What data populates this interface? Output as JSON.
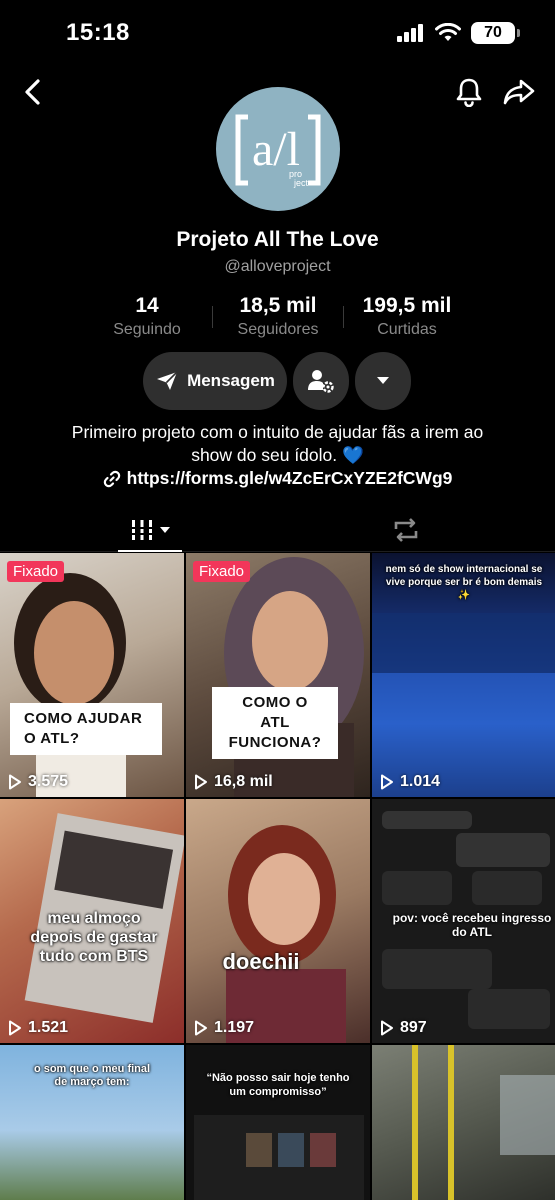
{
  "status_bar": {
    "time": "15:18",
    "battery": "70"
  },
  "profile": {
    "name": "Projeto All The Love",
    "handle": "@alloveproject",
    "avatar_text": "a/l",
    "avatar_sub": "pro ject"
  },
  "stats": [
    {
      "value": "14",
      "label": "Seguindo"
    },
    {
      "value": "18,5 mil",
      "label": "Seguidores"
    },
    {
      "value": "199,5 mil",
      "label": "Curtidas"
    }
  ],
  "actions": {
    "message_label": "Mensagem"
  },
  "bio": {
    "line1": "Primeiro projeto com o intuito de ajudar fãs a irem ao",
    "line2": "show do seu ídolo. 💙",
    "link": "https://forms.gle/w4ZcErCxYZE2fCWg9"
  },
  "videos": [
    {
      "pinned": "Fixado",
      "caption": "COMO AJUDAR O ATL?",
      "views": "3.575"
    },
    {
      "pinned": "Fixado",
      "caption": "COMO O ATL FUNCIONA?",
      "views": "16,8 mil"
    },
    {
      "caption": "nem só de show internacional se vive porque ser br é bom demais ✨",
      "views": "1.014"
    },
    {
      "caption": "meu almoço depois de gastar tudo com BTS",
      "views": "1.521"
    },
    {
      "caption": "doechii",
      "views": "1.197"
    },
    {
      "caption": "pov: você recebeu ingresso do ATL",
      "views": "897"
    },
    {
      "caption": "o som que o meu final de março tem:",
      "views": ""
    },
    {
      "caption": "“Não posso sair hoje tenho um compromisso”",
      "views": ""
    },
    {
      "caption": "",
      "views": ""
    }
  ],
  "colors": {
    "pinned_badge": "#f2365a",
    "background": "#000000",
    "heart": "#2d8cff"
  }
}
